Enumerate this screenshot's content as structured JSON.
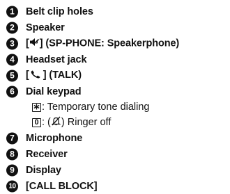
{
  "legend": {
    "items": [
      {
        "number": "1",
        "label": "Belt clip holes"
      },
      {
        "number": "2",
        "label": "Speaker"
      },
      {
        "number": "3",
        "prefix": "[",
        "icon": "speaker-phone-icon",
        "suffix": "] (SP-PHONE: Speakerphone)"
      },
      {
        "number": "4",
        "label": "Headset jack"
      },
      {
        "number": "5",
        "prefix": "[",
        "icon": "talk-handset-icon",
        "suffix": "] (TALK)"
      },
      {
        "number": "6",
        "label": "Dial keypad"
      },
      {
        "number": "7",
        "label": "Microphone"
      },
      {
        "number": "8",
        "label": "Receiver"
      },
      {
        "number": "9",
        "label": "Display"
      },
      {
        "number": "10",
        "label": "[CALL BLOCK]"
      }
    ],
    "dial_keypad_notes": [
      {
        "key_icon": "star-key-icon",
        "text": ": Temporary tone dialing"
      },
      {
        "key": "0",
        "text_before": ": (",
        "icon": "ringer-off-icon",
        "text_after": ") Ringer off"
      }
    ]
  }
}
